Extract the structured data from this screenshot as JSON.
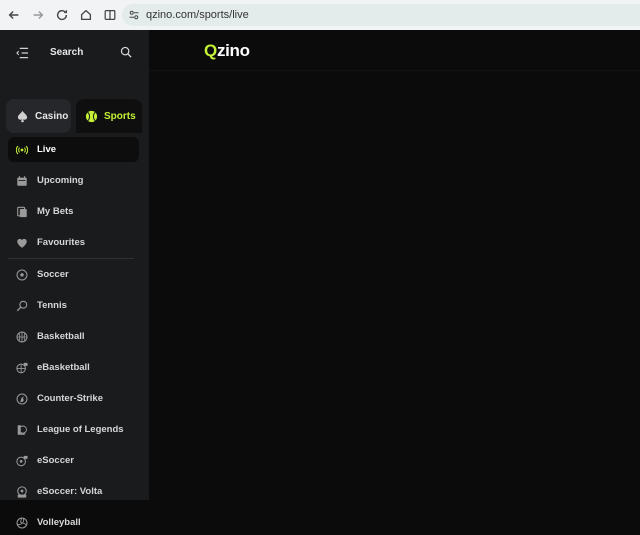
{
  "browser": {
    "url": "qzino.com/sports/live"
  },
  "sidebar": {
    "search_label": "Search",
    "tabs": [
      {
        "label": "Casino",
        "icon": "spade-icon"
      },
      {
        "label": "Sports",
        "icon": "tennis-ball-icon"
      }
    ],
    "items": [
      {
        "label": "Live",
        "icon": "broadcast-icon",
        "active": true
      },
      {
        "label": "Upcoming",
        "icon": "calendar-icon"
      },
      {
        "label": "My Bets",
        "icon": "tickets-icon"
      },
      {
        "label": "Favourites",
        "icon": "heart-icon"
      },
      {
        "label": "Soccer",
        "icon": "soccer-ball-icon"
      },
      {
        "label": "Tennis",
        "icon": "tennis-racket-icon"
      },
      {
        "label": "Basketball",
        "icon": "basketball-icon"
      },
      {
        "label": "eBasketball",
        "icon": "ebasketball-icon"
      },
      {
        "label": "Counter-Strike",
        "icon": "counter-strike-icon"
      },
      {
        "label": "League of Legends",
        "icon": "league-of-legends-icon"
      },
      {
        "label": "eSoccer",
        "icon": "esoccer-icon"
      },
      {
        "label": "eSoccer: Volta",
        "icon": "esoccer-volta-icon"
      },
      {
        "label": "Volleyball",
        "icon": "volleyball-icon"
      }
    ]
  },
  "header": {
    "logo_text": "zino",
    "logo_q": "Q"
  },
  "colors": {
    "accent": "#c4f135",
    "sidebar_bg": "#1a1b1d",
    "main_bg": "#0b0b0b"
  }
}
